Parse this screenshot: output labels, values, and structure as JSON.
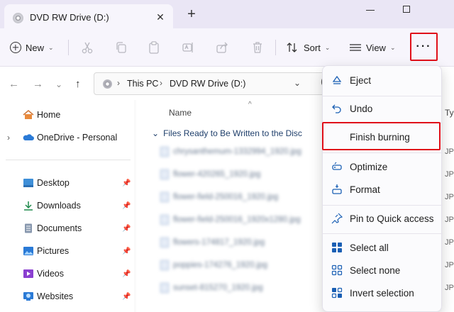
{
  "window": {
    "tab_title": "DVD RW Drive (D:)",
    "tab_close": "✕",
    "new_tab": "+"
  },
  "toolbar": {
    "new_label": "New",
    "sort_label": "Sort",
    "view_label": "View",
    "more_label": "···",
    "caret": "⌄"
  },
  "address": {
    "crumbs": [
      "This PC",
      "DVD RW Drive (D:)"
    ],
    "separator": "›",
    "chevron": "⌄",
    "back": "←",
    "forward": "→",
    "recent": "⌄",
    "up": "↑",
    "search_peek": "("
  },
  "sidebar": {
    "items": [
      {
        "label": "Home",
        "icon": "home-icon",
        "color": "#d0783a"
      },
      {
        "label": "OneDrive - Personal",
        "icon": "onedrive-icon",
        "color": "#2a7ad6",
        "expand": "›"
      },
      {
        "label": "Desktop",
        "icon": "desktop-icon",
        "color": "#3e8fd8",
        "pin": "📌"
      },
      {
        "label": "Downloads",
        "icon": "downloads-icon",
        "color": "#1f8a4c",
        "pin": "📌"
      },
      {
        "label": "Documents",
        "icon": "documents-icon",
        "color": "#6b7a91",
        "pin": "📌"
      },
      {
        "label": "Pictures",
        "icon": "pictures-icon",
        "color": "#2a7ad6",
        "pin": "📌"
      },
      {
        "label": "Videos",
        "icon": "videos-icon",
        "color": "#8a3fd0",
        "pin": "📌"
      },
      {
        "label": "Websites",
        "icon": "websites-icon",
        "color": "#2a7ad6",
        "pin": "📌"
      }
    ]
  },
  "content": {
    "col_name": "Name",
    "col_type": "Ty",
    "sort_caret": "^",
    "group": "Files Ready to Be Written to the Disc",
    "group_chevron": "⌄",
    "files": [
      {
        "name": "chrysanthemum-1332994_1920.jpg",
        "type": "JP"
      },
      {
        "name": "flower-420265_1920.jpg",
        "type": "JP"
      },
      {
        "name": "flower-field-250016_1920.jpg",
        "type": "JP"
      },
      {
        "name": "flower-field-250016_1920x1280.jpg",
        "type": "JP"
      },
      {
        "name": "flowers-174817_1920.jpg",
        "type": "JP"
      },
      {
        "name": "poppies-174276_1920.jpg",
        "type": "JP"
      },
      {
        "name": "sunset-815270_1920.jpg",
        "type": "JP"
      }
    ]
  },
  "menu": {
    "items": [
      {
        "label": "Eject",
        "icon": "eject-icon"
      },
      {
        "label": "Undo",
        "icon": "undo-icon"
      },
      {
        "label": "Finish burning",
        "icon": "none"
      },
      {
        "label": "Optimize",
        "icon": "optimize-icon"
      },
      {
        "label": "Format",
        "icon": "format-icon"
      },
      {
        "label": "Pin to Quick access",
        "icon": "pin-icon"
      },
      {
        "label": "Select all",
        "icon": "select-all-icon"
      },
      {
        "label": "Select none",
        "icon": "select-none-icon"
      },
      {
        "label": "Invert selection",
        "icon": "invert-selection-icon"
      }
    ]
  },
  "colors": {
    "accent": "#1a5fb4",
    "highlight_border": "#e0101a",
    "titlebar": "#eae6f5"
  }
}
